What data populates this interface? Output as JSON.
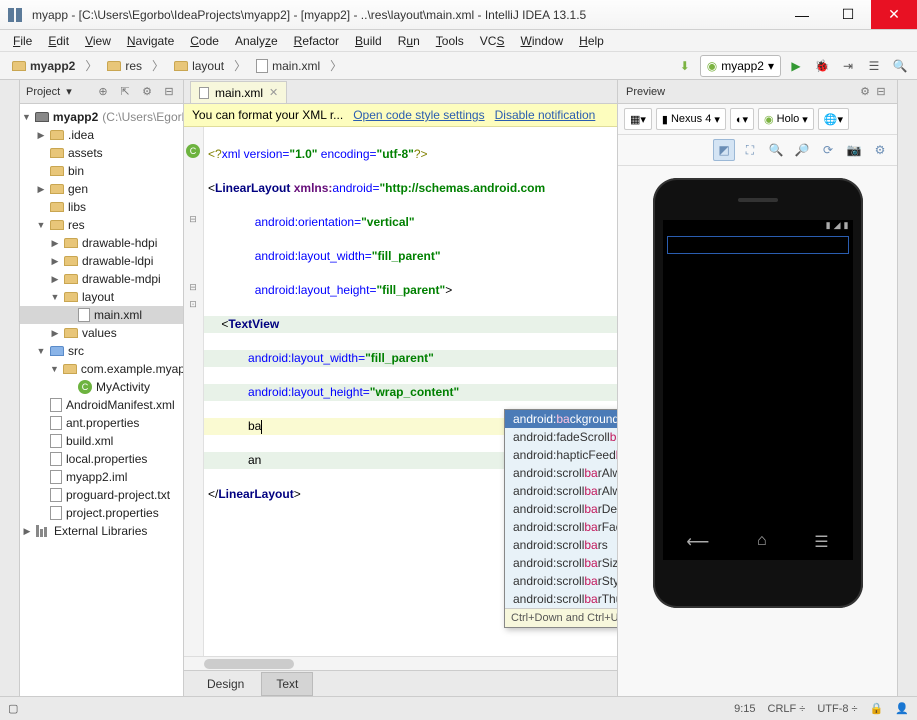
{
  "window": {
    "title": "myapp - [C:\\Users\\Egorbo\\IdeaProjects\\myapp2] - [myapp2] - ..\\res\\layout\\main.xml - IntelliJ IDEA 13.1.5"
  },
  "menu": [
    "File",
    "Edit",
    "View",
    "Navigate",
    "Code",
    "Analyze",
    "Refactor",
    "Build",
    "Run",
    "Tools",
    "VCS",
    "Window",
    "Help"
  ],
  "breadcrumbs": [
    "myapp2",
    "res",
    "layout",
    "main.xml"
  ],
  "run_config": "myapp2",
  "project_panel": {
    "title": "Project",
    "root": {
      "label": "myapp2",
      "path": "(C:\\Users\\Egorbo\\Id"
    },
    "tree": [
      {
        "depth": 1,
        "arrow": "▶",
        "icon": "folder",
        "label": ".idea"
      },
      {
        "depth": 1,
        "arrow": "",
        "icon": "folder",
        "label": "assets"
      },
      {
        "depth": 1,
        "arrow": "",
        "icon": "folder",
        "label": "bin"
      },
      {
        "depth": 1,
        "arrow": "▶",
        "icon": "folder",
        "label": "gen"
      },
      {
        "depth": 1,
        "arrow": "",
        "icon": "folder",
        "label": "libs"
      },
      {
        "depth": 1,
        "arrow": "▼",
        "icon": "folder",
        "label": "res"
      },
      {
        "depth": 2,
        "arrow": "▶",
        "icon": "folder",
        "label": "drawable-hdpi"
      },
      {
        "depth": 2,
        "arrow": "▶",
        "icon": "folder",
        "label": "drawable-ldpi"
      },
      {
        "depth": 2,
        "arrow": "▶",
        "icon": "folder",
        "label": "drawable-mdpi"
      },
      {
        "depth": 2,
        "arrow": "▼",
        "icon": "folder",
        "label": "layout"
      },
      {
        "depth": 3,
        "arrow": "",
        "icon": "xml",
        "label": "main.xml",
        "sel": true
      },
      {
        "depth": 2,
        "arrow": "▶",
        "icon": "folder",
        "label": "values"
      },
      {
        "depth": 1,
        "arrow": "▼",
        "icon": "folder-blue",
        "label": "src"
      },
      {
        "depth": 2,
        "arrow": "▼",
        "icon": "folder",
        "label": "com.example.myapp"
      },
      {
        "depth": 3,
        "arrow": "",
        "icon": "class",
        "label": "MyActivity"
      },
      {
        "depth": 1,
        "arrow": "",
        "icon": "xml",
        "label": "AndroidManifest.xml"
      },
      {
        "depth": 1,
        "arrow": "",
        "icon": "xml",
        "label": "ant.properties"
      },
      {
        "depth": 1,
        "arrow": "",
        "icon": "xml",
        "label": "build.xml"
      },
      {
        "depth": 1,
        "arrow": "",
        "icon": "xml",
        "label": "local.properties"
      },
      {
        "depth": 1,
        "arrow": "",
        "icon": "xml",
        "label": "myapp2.iml"
      },
      {
        "depth": 1,
        "arrow": "",
        "icon": "xml",
        "label": "proguard-project.txt"
      },
      {
        "depth": 1,
        "arrow": "",
        "icon": "xml",
        "label": "project.properties"
      }
    ],
    "external_libs": "External Libraries"
  },
  "editor": {
    "tab": "main.xml",
    "notification": {
      "text": "You can format your XML r...",
      "link1": "Open code style settings",
      "link2": "Disable notification"
    },
    "bottom_tabs": [
      "Design",
      "Text"
    ],
    "active_bottom": "Text",
    "caret": "9:15",
    "lineend": "CRLF",
    "encoding": "UTF-8"
  },
  "autocomplete": {
    "items": [
      {
        "text": "android:background",
        "match": "ba",
        "sel": true
      },
      {
        "text": "android:fadeScrollbars",
        "match": "ba"
      },
      {
        "text": "android:hapticFeedbackEnabled",
        "match": "ba"
      },
      {
        "text": "android:scrollbarAlwaysDrawHorizontalTrack",
        "match": "ba"
      },
      {
        "text": "android:scrollbarAlwaysDrawVerticalTrack",
        "match": "ba"
      },
      {
        "text": "android:scrollbarDefaultDelayBeforeFade",
        "match": "ba"
      },
      {
        "text": "android:scrollbarFadeDuration",
        "match": "ba"
      },
      {
        "text": "android:scrollbars",
        "match": "ba"
      },
      {
        "text": "android:scrollbarSize",
        "match": "ba"
      },
      {
        "text": "android:scrollbarStyle",
        "match": "ba"
      },
      {
        "text": "android:scrollbarThumbHorizontal",
        "match": "ba"
      }
    ],
    "hint": "Ctrl+Down and Ctrl+Up will move caret down and up in the editor",
    "hint_link": ">>"
  },
  "preview": {
    "title": "Preview",
    "device": "Nexus 4",
    "theme": "Holo"
  }
}
